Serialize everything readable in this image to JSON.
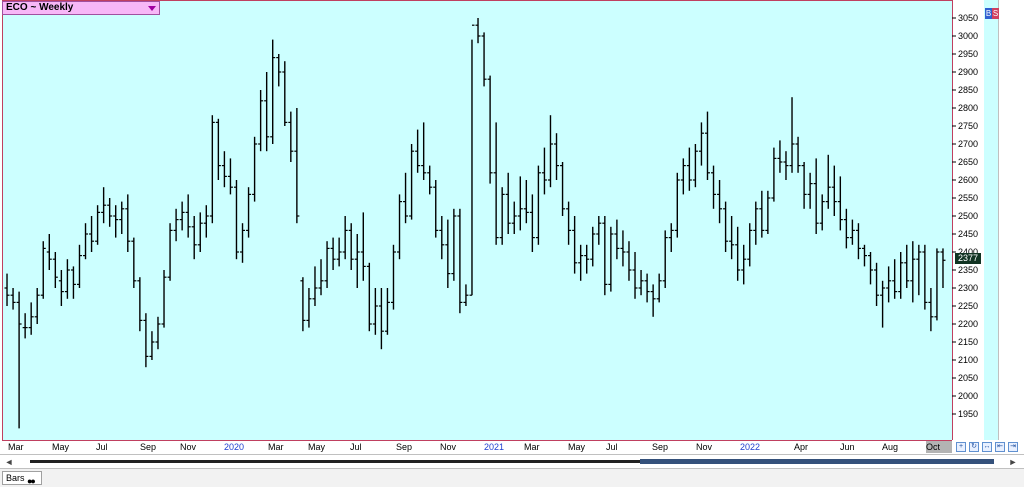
{
  "title": "ECO ~ Weekly",
  "last_price": "2377",
  "footer": {
    "tab_label": "Bars",
    "dots": "●●"
  },
  "controls": {
    "b": "B",
    "s": "S",
    "scroll_left": "◄",
    "scroll_right": "►"
  },
  "colors": {
    "background": "#ccffff",
    "bar": "#000000",
    "frame": "#c04060",
    "title_bg": "#f7b7f7",
    "year_label": "#2040d0"
  },
  "chart_data": {
    "type": "ohlc",
    "title": "ECO ~ Weekly",
    "ylim": [
      1900,
      3100
    ],
    "y_ticks": [
      1950,
      2000,
      2050,
      2100,
      2150,
      2200,
      2250,
      2300,
      2350,
      2400,
      2450,
      2500,
      2550,
      2600,
      2650,
      2700,
      2750,
      2800,
      2850,
      2900,
      2950,
      3000,
      3050
    ],
    "x_ticks": [
      {
        "label": "Mar",
        "year": false
      },
      {
        "label": "May",
        "year": false
      },
      {
        "label": "Jul",
        "year": false
      },
      {
        "label": "Sep",
        "year": false
      },
      {
        "label": "Nov",
        "year": false
      },
      {
        "label": "2020",
        "year": true
      },
      {
        "label": "Mar",
        "year": false
      },
      {
        "label": "May",
        "year": false
      },
      {
        "label": "Jul",
        "year": false
      },
      {
        "label": "Sep",
        "year": false
      },
      {
        "label": "Nov",
        "year": false
      },
      {
        "label": "2021",
        "year": true
      },
      {
        "label": "Mar",
        "year": false
      },
      {
        "label": "May",
        "year": false
      },
      {
        "label": "Jul",
        "year": false
      },
      {
        "label": "Sep",
        "year": false
      },
      {
        "label": "Nov",
        "year": false
      },
      {
        "label": "2022",
        "year": true
      },
      {
        "label": "Apr",
        "year": false
      },
      {
        "label": "Jun",
        "year": false
      },
      {
        "label": "Aug",
        "year": false
      },
      {
        "label": "Oct",
        "year": false
      }
    ],
    "grid": false,
    "series": [
      {
        "name": "ECO",
        "bars": [
          [
            2300,
            2340,
            2250,
            2280
          ],
          [
            2280,
            2300,
            2240,
            2260
          ],
          [
            2260,
            2290,
            1910,
            2200
          ],
          [
            2190,
            2230,
            2160,
            2190
          ],
          [
            2190,
            2260,
            2170,
            2220
          ],
          [
            2220,
            2300,
            2200,
            2280
          ],
          [
            2280,
            2430,
            2270,
            2410
          ],
          [
            2400,
            2450,
            2350,
            2380
          ],
          [
            2380,
            2400,
            2300,
            2330
          ],
          [
            2320,
            2350,
            2250,
            2290
          ],
          [
            2290,
            2380,
            2270,
            2350
          ],
          [
            2350,
            2360,
            2270,
            2310
          ],
          [
            2310,
            2420,
            2300,
            2390
          ],
          [
            2390,
            2480,
            2380,
            2450
          ],
          [
            2450,
            2500,
            2400,
            2430
          ],
          [
            2430,
            2530,
            2420,
            2510
          ],
          [
            2510,
            2580,
            2480,
            2530
          ],
          [
            2530,
            2550,
            2470,
            2500
          ],
          [
            2500,
            2530,
            2440,
            2490
          ],
          [
            2490,
            2540,
            2450,
            2520
          ],
          [
            2520,
            2560,
            2400,
            2430
          ],
          [
            2430,
            2440,
            2300,
            2320
          ],
          [
            2320,
            2330,
            2180,
            2210
          ],
          [
            2210,
            2230,
            2080,
            2110
          ],
          [
            2110,
            2180,
            2100,
            2150
          ],
          [
            2150,
            2220,
            2130,
            2200
          ],
          [
            2200,
            2350,
            2190,
            2330
          ],
          [
            2330,
            2480,
            2320,
            2460
          ],
          [
            2460,
            2520,
            2430,
            2490
          ],
          [
            2490,
            2540,
            2460,
            2510
          ],
          [
            2510,
            2560,
            2440,
            2470
          ],
          [
            2470,
            2500,
            2380,
            2420
          ],
          [
            2420,
            2510,
            2400,
            2480
          ],
          [
            2480,
            2530,
            2440,
            2500
          ],
          [
            2500,
            2780,
            2480,
            2760
          ],
          [
            2760,
            2770,
            2600,
            2640
          ],
          [
            2640,
            2680,
            2580,
            2610
          ],
          [
            2610,
            2660,
            2560,
            2580
          ],
          [
            2580,
            2600,
            2380,
            2400
          ],
          [
            2400,
            2480,
            2370,
            2460
          ],
          [
            2460,
            2580,
            2440,
            2560
          ],
          [
            2560,
            2720,
            2540,
            2700
          ],
          [
            2700,
            2850,
            2680,
            2820
          ],
          [
            2820,
            2900,
            2680,
            2720
          ],
          [
            2720,
            2990,
            2700,
            2940
          ],
          [
            2940,
            2950,
            2860,
            2900
          ],
          [
            2900,
            2930,
            2750,
            2760
          ],
          [
            2760,
            2790,
            2650,
            2680
          ],
          [
            2680,
            2800,
            2480,
            2500
          ],
          [
            2320,
            2330,
            2180,
            2210
          ],
          [
            2210,
            2300,
            2190,
            2270
          ],
          [
            2270,
            2360,
            2250,
            2300
          ],
          [
            2300,
            2380,
            2280,
            2320
          ],
          [
            2320,
            2430,
            2300,
            2410
          ],
          [
            2410,
            2440,
            2350,
            2380
          ],
          [
            2380,
            2440,
            2360,
            2400
          ],
          [
            2400,
            2500,
            2380,
            2460
          ],
          [
            2460,
            2480,
            2350,
            2380
          ],
          [
            2380,
            2450,
            2300,
            2400
          ],
          [
            2400,
            2510,
            2320,
            2360
          ],
          [
            2360,
            2370,
            2180,
            2200
          ],
          [
            2200,
            2300,
            2170,
            2250
          ],
          [
            2250,
            2300,
            2130,
            2180
          ],
          [
            2180,
            2300,
            2170,
            2260
          ],
          [
            2260,
            2420,
            2240,
            2400
          ],
          [
            2400,
            2560,
            2380,
            2540
          ],
          [
            2540,
            2620,
            2480,
            2500
          ],
          [
            2500,
            2700,
            2490,
            2680
          ],
          [
            2680,
            2740,
            2620,
            2640
          ],
          [
            2640,
            2760,
            2600,
            2620
          ],
          [
            2620,
            2640,
            2560,
            2580
          ],
          [
            2580,
            2600,
            2440,
            2460
          ],
          [
            2460,
            2500,
            2380,
            2420
          ],
          [
            2420,
            2490,
            2300,
            2340
          ],
          [
            2340,
            2520,
            2320,
            2500
          ],
          [
            2500,
            2520,
            2230,
            2260
          ],
          [
            2260,
            2310,
            2250,
            2280
          ],
          [
            2280,
            2990,
            2280,
            3030
          ],
          [
            3030,
            3050,
            2980,
            3000
          ],
          [
            3000,
            3010,
            2860,
            2880
          ],
          [
            2880,
            2890,
            2590,
            2620
          ],
          [
            2620,
            2760,
            2420,
            2440
          ],
          [
            2440,
            2580,
            2420,
            2560
          ],
          [
            2560,
            2620,
            2450,
            2480
          ],
          [
            2480,
            2540,
            2450,
            2500
          ],
          [
            2500,
            2610,
            2460,
            2520
          ],
          [
            2520,
            2600,
            2480,
            2510
          ],
          [
            2510,
            2560,
            2400,
            2440
          ],
          [
            2440,
            2640,
            2420,
            2620
          ],
          [
            2620,
            2690,
            2560,
            2600
          ],
          [
            2600,
            2780,
            2580,
            2700
          ],
          [
            2700,
            2730,
            2600,
            2640
          ],
          [
            2640,
            2650,
            2500,
            2520
          ],
          [
            2520,
            2540,
            2420,
            2460
          ],
          [
            2460,
            2500,
            2340,
            2370
          ],
          [
            2370,
            2420,
            2320,
            2390
          ],
          [
            2390,
            2420,
            2340,
            2380
          ],
          [
            2380,
            2470,
            2360,
            2450
          ],
          [
            2450,
            2500,
            2420,
            2480
          ],
          [
            2480,
            2500,
            2280,
            2310
          ],
          [
            2310,
            2470,
            2290,
            2450
          ],
          [
            2450,
            2490,
            2380,
            2410
          ],
          [
            2410,
            2460,
            2360,
            2400
          ],
          [
            2400,
            2430,
            2320,
            2350
          ],
          [
            2350,
            2400,
            2270,
            2300
          ],
          [
            2300,
            2350,
            2280,
            2320
          ],
          [
            2320,
            2340,
            2260,
            2290
          ],
          [
            2290,
            2310,
            2220,
            2270
          ],
          [
            2270,
            2340,
            2260,
            2320
          ],
          [
            2320,
            2460,
            2300,
            2440
          ],
          [
            2440,
            2480,
            2400,
            2460
          ],
          [
            2460,
            2620,
            2440,
            2600
          ],
          [
            2600,
            2660,
            2560,
            2640
          ],
          [
            2640,
            2690,
            2570,
            2600
          ],
          [
            2600,
            2700,
            2580,
            2680
          ],
          [
            2680,
            2760,
            2640,
            2730
          ],
          [
            2730,
            2790,
            2600,
            2620
          ],
          [
            2620,
            2640,
            2520,
            2560
          ],
          [
            2560,
            2600,
            2480,
            2520
          ],
          [
            2520,
            2540,
            2400,
            2430
          ],
          [
            2430,
            2500,
            2380,
            2420
          ],
          [
            2420,
            2470,
            2320,
            2350
          ],
          [
            2350,
            2420,
            2310,
            2380
          ],
          [
            2380,
            2480,
            2360,
            2460
          ],
          [
            2460,
            2540,
            2420,
            2520
          ],
          [
            2520,
            2570,
            2440,
            2460
          ],
          [
            2460,
            2570,
            2450,
            2550
          ],
          [
            2550,
            2690,
            2540,
            2660
          ],
          [
            2660,
            2710,
            2620,
            2650
          ],
          [
            2650,
            2680,
            2600,
            2640
          ],
          [
            2640,
            2830,
            2620,
            2700
          ],
          [
            2700,
            2720,
            2620,
            2640
          ],
          [
            2640,
            2650,
            2520,
            2560
          ],
          [
            2560,
            2620,
            2520,
            2590
          ],
          [
            2590,
            2660,
            2450,
            2480
          ],
          [
            2480,
            2560,
            2460,
            2540
          ],
          [
            2540,
            2670,
            2520,
            2580
          ],
          [
            2580,
            2640,
            2500,
            2540
          ],
          [
            2540,
            2610,
            2460,
            2490
          ],
          [
            2490,
            2520,
            2410,
            2440
          ],
          [
            2440,
            2490,
            2420,
            2460
          ],
          [
            2460,
            2480,
            2380,
            2410
          ],
          [
            2410,
            2420,
            2360,
            2390
          ],
          [
            2390,
            2400,
            2310,
            2350
          ],
          [
            2350,
            2370,
            2250,
            2280
          ],
          [
            2280,
            2320,
            2190,
            2300
          ],
          [
            2300,
            2360,
            2260,
            2320
          ],
          [
            2320,
            2380,
            2270,
            2290
          ],
          [
            2290,
            2400,
            2270,
            2370
          ],
          [
            2370,
            2420,
            2300,
            2320
          ],
          [
            2320,
            2430,
            2260,
            2380
          ],
          [
            2380,
            2420,
            2280,
            2400
          ],
          [
            2400,
            2420,
            2240,
            2260
          ],
          [
            2260,
            2300,
            2180,
            2220
          ],
          [
            2220,
            2410,
            2210,
            2400
          ],
          [
            2400,
            2410,
            2300,
            2377
          ]
        ]
      }
    ]
  }
}
